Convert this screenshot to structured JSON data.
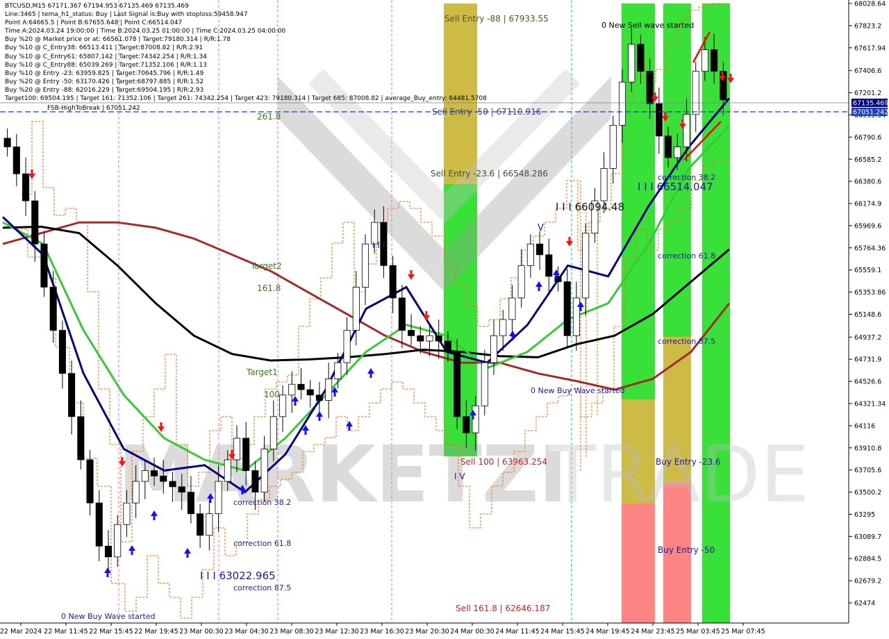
{
  "info_lines": [
    "BTCUSD,M15   67171.367 67194.953 67135.469 67135.469",
    "Line:3465  |  tema_h1_status: Buy  |  Last Signal is:Buy with stoploss:59458.947",
    "Point A:64665.5  |  Point B:67655.648  |  Point C:66514.047",
    "Time A:2024.03.24 19:00:00  |  Time B:2024.03.25 01:00:00  |  Time C:2024.03.25 04:00:00",
    "Buy %20 @ Market price or at: 66561.078  |  Target:79180.314  |  R/R:1.78",
    "Buy %10 @ C_Entry38: 66513.411  |  Target:87008.82  |  R/R:2.91",
    "Buy %10 @ C_Entry61: 65807.142  |  Target:74342.254  |  R/R:1.34",
    "Buy %10 @ C_Entry88: 65039.269  |  Target:71352.106  |  R/R:1.13",
    "Buy %10 @ Entry -23: 63959.825  |  Target:70645.796  |  R/R:1.49",
    "Buy %20 @ Entry -50: 63170.426  |  Target:68797.885  |  R/R:1.52",
    "Buy %20 @ Entry -88: 62016.229  |  Target:69504.195  |  R/R:2.93",
    "Target100: 69504.195  |  Target 161: 71352.106  |  Target 261: 74342.254  |  Target 423: 79180.314  |  Target 685: 87008.82  |  average_Buy_entry: 64481.5708"
  ],
  "fsb_label": "FSB-HighToBreak  |  67051.242",
  "colors": {
    "grid": "#c8c8c8",
    "bull_candle": "#000000",
    "sell_zone": "#c8b432",
    "buy_green": "#22dd22",
    "buy_red": "#ff6666",
    "ma_dark_red": "#a52a2a",
    "ma_black": "#000000",
    "ma_green": "#33cc33",
    "ma_navy": "#000080",
    "price_box": "#000080",
    "fsb_box": "#1a3fbf",
    "magenta_vline": "#ff66cc",
    "cyan_vline": "#00bcd4",
    "watermark": "#b0b0b0"
  },
  "labels": {
    "sell_entry_88": "Sell Entry -88 | 67933.55",
    "sell_entry_50": "Sell Entry -50 | 67110.916",
    "sell_entry_23": "Sell Entry -23.6 | 66548.286",
    "sell_100": "Sell 100 | 63963.254",
    "sell_161": "Sell 161.8 | 62646.187",
    "new_sell_wave": "0 New Sell wave started",
    "new_buy_wave_1": "0 New Buy Wave started",
    "new_buy_wave_2": "0 New Buy Wave started",
    "val_66514": "I I I 66514.047",
    "val_66094": "I I I 66094.48",
    "val_63022": "I I I 63022.965",
    "corr_382_a": "correction 38.2",
    "corr_618_a": "correction 61.8",
    "corr_875_a": "correction 87.5",
    "corr_382_b": "correction 38.2",
    "corr_618_b": "correction 61.8",
    "corr_875_b": "correction 87.5",
    "buy_entry_23": "Buy Entry -23.6",
    "buy_entry_50": "Buy Entry -50",
    "fib_261": "261.8",
    "fib_target2": "Target2",
    "fib_161": "161.8",
    "fib_target1": "Target1",
    "fib_100": "100",
    "wave_v_1": "V",
    "wave_v_2": "V",
    "wave_iii": "I I I",
    "wave_iv": "I V",
    "watermark_left": "MARKETZI",
    "watermark_right": "TRADE"
  },
  "chart_data": {
    "type": "candlestick",
    "symbol": "BTCUSD",
    "timeframe": "M15",
    "y_ticks": [
      68028.64,
      67823.2,
      67617.94,
      67406.6,
      67201.2,
      66995.94,
      66790.6,
      66585.2,
      66380.6,
      66174.9,
      65969.6,
      65764.36,
      65559.1,
      65353.86,
      65148.6,
      64937.2,
      64731.9,
      64526.6,
      64321.34,
      64116.0,
      63910.8,
      63705.6,
      63500.2,
      63295.0,
      63089.7,
      62884.5,
      62679.2,
      62474.0
    ],
    "ylim": [
      62474.0,
      68028.64
    ],
    "x_ticks": [
      "22 Mar 2024",
      "22 Mar 11:45",
      "22 Mar 15:45",
      "22 Mar 19:45",
      "23 Mar 00:30",
      "23 Mar 04:30",
      "23 Mar 08:30",
      "23 Mar 12:30",
      "23 Mar 16:30",
      "23 Mar 20:30",
      "24 Mar 00:30",
      "24 Mar 11:45",
      "24 Mar 15:45",
      "24 Mar 19:45",
      "24 Mar 23:45",
      "25 Mar 03:45",
      "25 Mar 07:45"
    ],
    "current_price": "67135.469",
    "fsb_price": "67051.242",
    "closes": [
      66700,
      66450,
      66200,
      65800,
      65400,
      65000,
      64600,
      64200,
      63800,
      63400,
      63000,
      62900,
      63200,
      63400,
      63600,
      63700,
      63650,
      63600,
      63550,
      63500,
      63300,
      63100,
      63300,
      63600,
      63800,
      64000,
      63700,
      63500,
      63900,
      64200,
      64400,
      64500,
      64450,
      64400,
      64350,
      64550,
      64700,
      65000,
      65400,
      65800,
      66000,
      65600,
      65300,
      65000,
      64950,
      64900,
      64950,
      64900,
      64800,
      64200,
      64050,
      64300,
      64700,
      64950,
      65100,
      65300,
      65600,
      65800,
      65700,
      65500,
      65450,
      64950,
      65300,
      65900,
      66200,
      66500,
      66900,
      67300,
      67650,
      67400,
      67100,
      66800,
      66600,
      66700,
      67000,
      67400,
      67600,
      67400,
      67135
    ],
    "series": [
      {
        "name": "ma_dark_red",
        "values": [
          65800,
          65900,
          66000,
          66000,
          65950,
          65850,
          65700,
          65550,
          65350,
          65150,
          64950,
          64800,
          64700,
          64700,
          64600,
          64530,
          64450,
          64550,
          64800,
          65250
        ]
      },
      {
        "name": "ma_black",
        "values": [
          65950,
          65960,
          65900,
          65600,
          65250,
          64950,
          64780,
          64720,
          64730,
          64750,
          64780,
          64820,
          64800,
          64760,
          64750,
          64870,
          64950,
          65150,
          65450,
          65750
        ]
      },
      {
        "name": "ma_green",
        "values": [
          66000,
          65800,
          65000,
          64400,
          64000,
          63800,
          63700,
          64000,
          64400,
          64800,
          65050,
          64950,
          64650,
          64800,
          65100,
          65250,
          65800,
          66500,
          66900
        ]
      },
      {
        "name": "ma_navy",
        "values": [
          66050,
          65700,
          64600,
          63900,
          63700,
          63750,
          63500,
          63850,
          64450,
          65200,
          65400,
          64800,
          64700,
          65050,
          65600,
          65500,
          66150,
          66700,
          67150
        ]
      }
    ]
  }
}
